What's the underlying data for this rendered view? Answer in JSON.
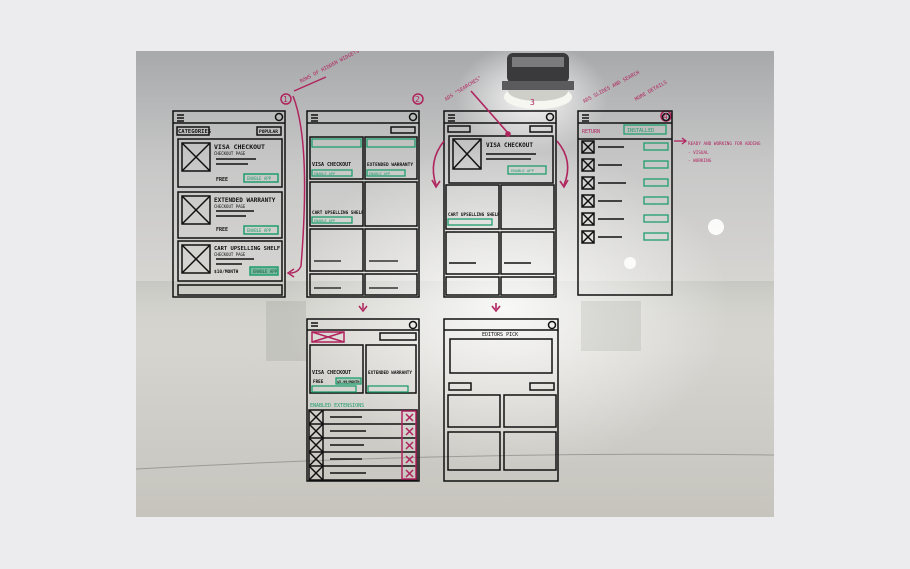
{
  "photo": {
    "subject": "whiteboard-wireframes",
    "notes": {
      "n1": "ROWS OF HIDDEN WIDGETS",
      "n2": "ADS \"SEARCHES\"",
      "n3": "ADS SLIDES AND SEARCH",
      "n4": "MORE DETAILS",
      "n5": "READY AND WORKING FOR ADDING",
      "n6": "- VISUAL",
      "n7": "- WORKING"
    },
    "step_numbers": [
      "1",
      "2",
      "3",
      "4"
    ],
    "frame1": {
      "top_select": "CATEGORIES",
      "top_tab": "POPULAR",
      "items": [
        {
          "title": "VISA CHECKOUT",
          "sub": "CHECKOUT PAGE",
          "free": "FREE",
          "btn": "ENABLE APP"
        },
        {
          "title": "EXTENDED WARRANTY",
          "sub": "CHECKOUT PAGE",
          "free": "FREE",
          "btn": "ENABLE APP"
        },
        {
          "title": "CART UPSELLING SHELF",
          "sub": "CHECKOUT PAGE",
          "free": "$10/MONTH",
          "btn": "ENABLE APP"
        }
      ]
    },
    "frame2": {
      "cards": [
        "VISA CHECKOUT",
        "EXTENDED WARRANTY",
        "CART UPSELLING SHELF"
      ],
      "btn": "ENABLE APP"
    },
    "frame3": {
      "title": "VISA CHECKOUT",
      "btn": "ENABLE APP",
      "card": "CART UPSELLING SHELF"
    },
    "frame4": {
      "left_tab": "RETURN",
      "right_tab": "INSTALLED"
    },
    "frame5": {
      "cards": [
        "VISA CHECKOUT",
        "EXTENDED WARRANTY"
      ],
      "free": "FREE",
      "price": "$5.99/MONTH",
      "section": "ENABLED EXTENSIONS"
    },
    "frame6": {
      "header": "EDITORS PICK"
    }
  },
  "colors": {
    "background": "#ecebed",
    "marker_red": "#b0245e",
    "marker_green": "#1f9e6d",
    "marker_black": "#111111"
  }
}
